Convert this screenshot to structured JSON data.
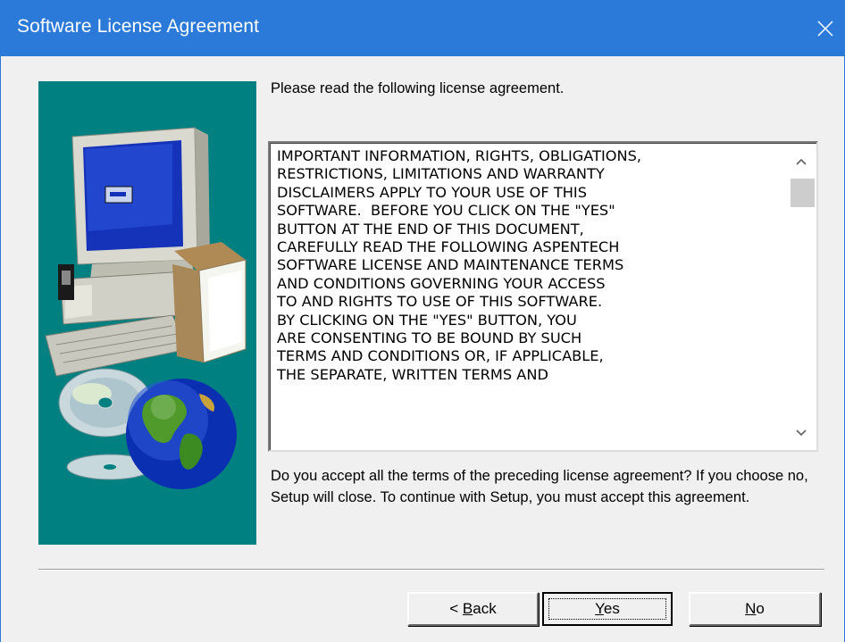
{
  "window": {
    "title": "Software License Agreement",
    "close_glyph": "✕"
  },
  "colors": {
    "titlebar": "#2b79d8",
    "art_background": "#008080",
    "dialog_background": "#f0f0f0"
  },
  "prompt": "Please read the following license agreement.",
  "license": {
    "text": "IMPORTANT INFORMATION, RIGHTS, OBLIGATIONS,\nRESTRICTIONS, LIMITATIONS AND WARRANTY\nDISCLAIMERS APPLY TO YOUR USE OF THIS\nSOFTWARE.  BEFORE YOU CLICK ON THE \"YES\"\nBUTTON AT THE END OF THIS DOCUMENT,\nCAREFULLY READ THE FOLLOWING ASPENTECH\nSOFTWARE LICENSE AND MAINTENANCE TERMS\nAND CONDITIONS GOVERNING YOUR ACCESS\nTO AND RIGHTS TO USE OF THIS SOFTWARE.\nBY CLICKING ON THE \"YES\" BUTTON, YOU\nARE CONSENTING TO BE BOUND BY SUCH\nTERMS AND CONDITIONS OR, IF APPLICABLE,\nTHE SEPARATE, WRITTEN TERMS AND"
  },
  "question": "Do you accept all the terms of the preceding license agreement?  If you choose no, Setup will close.  To continue with Setup, you must accept this agreement.",
  "buttons": {
    "back_prefix": "< ",
    "back_accel": "B",
    "back_rest": "ack",
    "yes_accel": "Y",
    "yes_rest": "es",
    "no_accel": "N",
    "no_rest": "o"
  },
  "icons": {
    "close": "close-icon",
    "scroll_up": "chevron-up-icon",
    "scroll_down": "chevron-down-icon",
    "artwork": "computer-cd-globe-illustration"
  }
}
